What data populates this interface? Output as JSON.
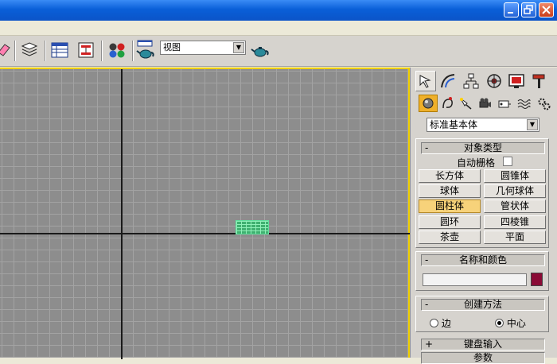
{
  "toolbar": {
    "view_select": "视图"
  },
  "panel": {
    "category_select": "标准基本体",
    "rollouts": {
      "object_type": {
        "collapse_symbol": "-",
        "title": "对象类型",
        "autogrid_label": "自动栅格",
        "buttons": [
          "长方体",
          "圆锥体",
          "球体",
          "几何球体",
          "圆柱体",
          "管状体",
          "圆环",
          "四棱锥",
          "茶壶",
          "平面"
        ],
        "selected": "圆柱体"
      },
      "name_color": {
        "collapse_symbol": "-",
        "title": "名称和颜色",
        "color": "#8a0a35"
      },
      "creation_method": {
        "collapse_symbol": "-",
        "title": "创建方法",
        "options": [
          "边",
          "中心"
        ]
      },
      "keyboard_entry": {
        "collapse_symbol": "+",
        "title": "键盘输入"
      },
      "parameters": {
        "title": "参数"
      }
    }
  },
  "colors": {
    "viewport_border": "#f0d000",
    "titlebar": "#0b54c8"
  }
}
